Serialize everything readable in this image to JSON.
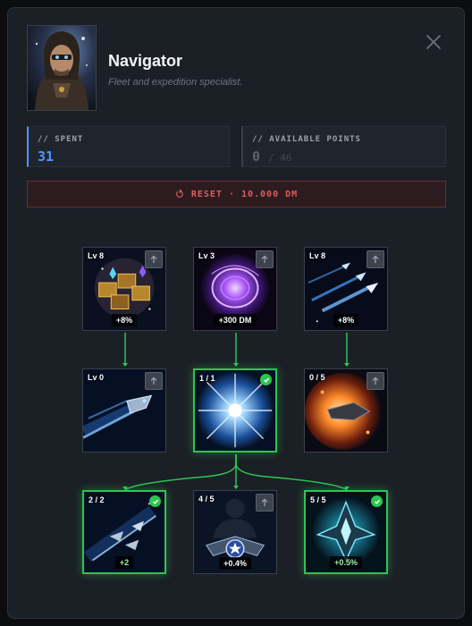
{
  "header": {
    "title": "Navigator",
    "subtitle": "Fleet and expedition specialist."
  },
  "stats": {
    "spent_label": "// SPENT",
    "spent_value": "31",
    "available_label": "// AVAILABLE POINTS",
    "available_value": "0",
    "available_max": "/ 46"
  },
  "reset": {
    "label": "RESET · 10.000 DM"
  },
  "nodes": [
    {
      "level": "Lv 8",
      "bonus": "+8%",
      "status": "upgradable",
      "icon": "resource-crates"
    },
    {
      "level": "Lv 3",
      "bonus": "+300 DM",
      "status": "upgradable",
      "icon": "purple-portal"
    },
    {
      "level": "Lv 8",
      "bonus": "+8%",
      "status": "upgradable",
      "icon": "fleet-ships"
    },
    {
      "level": "Lv 0",
      "bonus": "",
      "status": "upgradable",
      "icon": "warp-ship"
    },
    {
      "level": "1 / 1",
      "bonus": "",
      "status": "completed",
      "icon": "light-burst"
    },
    {
      "level": "0 / 5",
      "bonus": "",
      "status": "upgradable",
      "icon": "explosion-ship"
    },
    {
      "level": "2 / 2",
      "bonus": "+2",
      "status": "completed",
      "icon": "fleet-squadron"
    },
    {
      "level": "4 / 5",
      "bonus": "+0.4%",
      "status": "upgradable",
      "icon": "commander-emblem"
    },
    {
      "level": "5 / 5",
      "bonus": "+0.5%",
      "status": "completed",
      "icon": "crystal-ship"
    }
  ],
  "colors": {
    "accent_blue": "#4f96ff",
    "complete_green": "#2fc452",
    "reset_red": "#e0595c"
  }
}
